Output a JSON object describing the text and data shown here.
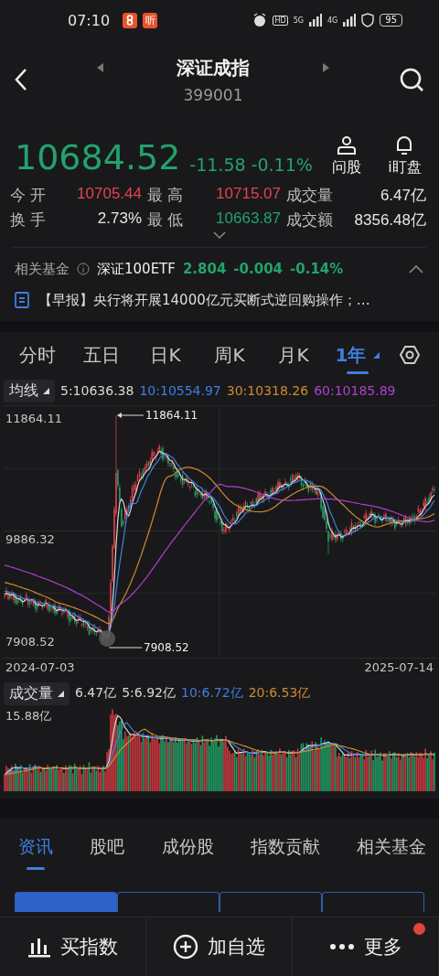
{
  "status_bar": {
    "time": "07:10",
    "apps": [
      {
        "kind": "app"
      },
      {
        "kind": "glyph",
        "glyph": "听"
      }
    ],
    "hd": "HD",
    "networks": [
      "5G",
      "4G"
    ],
    "battery": "95"
  },
  "header": {
    "title": "深证成指",
    "code": "399001"
  },
  "quote": {
    "price": "10684.52",
    "change": "-11.58",
    "change_pct": "-0.11%"
  },
  "actions": [
    {
      "kind": "person",
      "label": "问股"
    },
    {
      "kind": "bell",
      "label": "i盯盘"
    }
  ],
  "stats": [
    [
      {
        "label": "今 开",
        "value": "10705.44",
        "color": "#e2434b"
      },
      {
        "label": "最 高",
        "value": "10715.07",
        "color": "#e2434b"
      },
      {
        "label": "成交量",
        "value": "6.47亿",
        "color": "#e6e6e6"
      }
    ],
    [
      {
        "label": "换 手",
        "value": "2.73%",
        "color": "#e6e6e6"
      },
      {
        "label": "最 低",
        "value": "10663.87",
        "color": "#23a26c"
      },
      {
        "label": "成交额",
        "value": "8356.48亿",
        "color": "#e6e6e6"
      }
    ]
  ],
  "related_fund": {
    "label": "相关基金",
    "name": "深证100ETF",
    "price": "2.804",
    "change": "-0.004",
    "change_pct": "-0.14%"
  },
  "news": {
    "text": "【早报】央行将开展14000亿元买断式逆回购操作；…"
  },
  "periods": [
    {
      "label": "分时",
      "kind": "plain",
      "selected": false
    },
    {
      "label": "五日",
      "kind": "plain",
      "selected": false
    },
    {
      "label": "日K",
      "kind": "plain",
      "selected": false
    },
    {
      "label": "周K",
      "kind": "plain",
      "selected": false
    },
    {
      "label": "月K",
      "kind": "plain",
      "selected": false
    },
    {
      "label": "1年",
      "kind": "dropdown",
      "selected": true
    }
  ],
  "ma": {
    "button": "均线",
    "values": [
      {
        "text": "5:10636.38",
        "color": "#d8d8d8"
      },
      {
        "text": "10:10554.97",
        "color": "#3f7fe0"
      },
      {
        "text": "30:10318.26",
        "color": "#d08a2c"
      },
      {
        "text": "60:10185.89",
        "color": "#b03fd0"
      }
    ]
  },
  "price_chart": {
    "y_labels": [
      "11864.11",
      "9886.32",
      "7908.52"
    ],
    "high_marker": "11864.11",
    "low_marker": "7908.52",
    "start_date": "2024-07-03",
    "end_date": "2025-07-14"
  },
  "volume": {
    "button": "成交量",
    "values": [
      {
        "text": "6.47亿",
        "color": "#d8d8d8"
      },
      {
        "text": "5:6.92亿",
        "color": "#d8d8d8"
      },
      {
        "text": "10:6.72亿",
        "color": "#3f7fe0"
      },
      {
        "text": "20:6.53亿",
        "color": "#d08a2c"
      }
    ],
    "y_label": "15.88亿"
  },
  "content_tabs": [
    {
      "label": "资讯",
      "selected": true
    },
    {
      "label": "股吧",
      "selected": false
    },
    {
      "label": "成份股",
      "selected": false
    },
    {
      "label": "指数贡献",
      "selected": false
    },
    {
      "label": "相关基金",
      "selected": false
    }
  ],
  "filters": [
    {
      "selected": true
    },
    {
      "selected": false
    },
    {
      "selected": false
    },
    {
      "selected": false
    }
  ],
  "bottom_actions": [
    {
      "kind": "chart",
      "label": "买指数",
      "badge": false
    },
    {
      "kind": "add",
      "label": "加自选",
      "badge": false
    },
    {
      "kind": "more",
      "label": "更多",
      "badge": true
    }
  ]
}
